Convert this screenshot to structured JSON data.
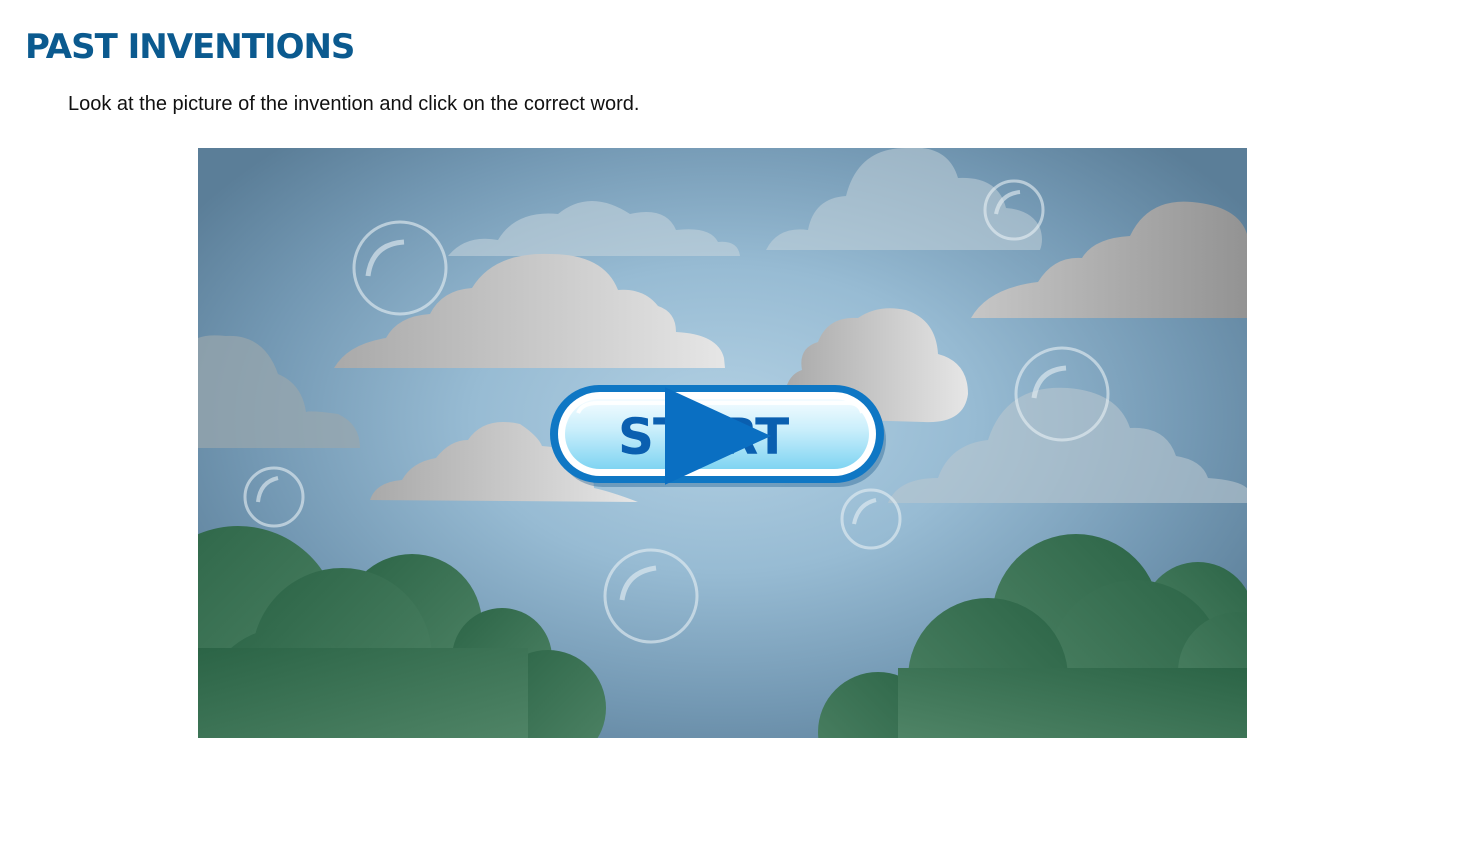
{
  "page": {
    "title": "PAST INVENTIONS",
    "instructions": "Look at the picture of the invention and click on the correct word."
  },
  "game": {
    "start_label": "START",
    "start_icon": "play-icon"
  },
  "colors": {
    "title": "#0b5a8f",
    "button_text": "#0a5fb0",
    "button_border": "#0f77c4",
    "sky_center": "#b2d0e3",
    "sky_edge": "#5b7e98",
    "trees": "#3f7457"
  }
}
